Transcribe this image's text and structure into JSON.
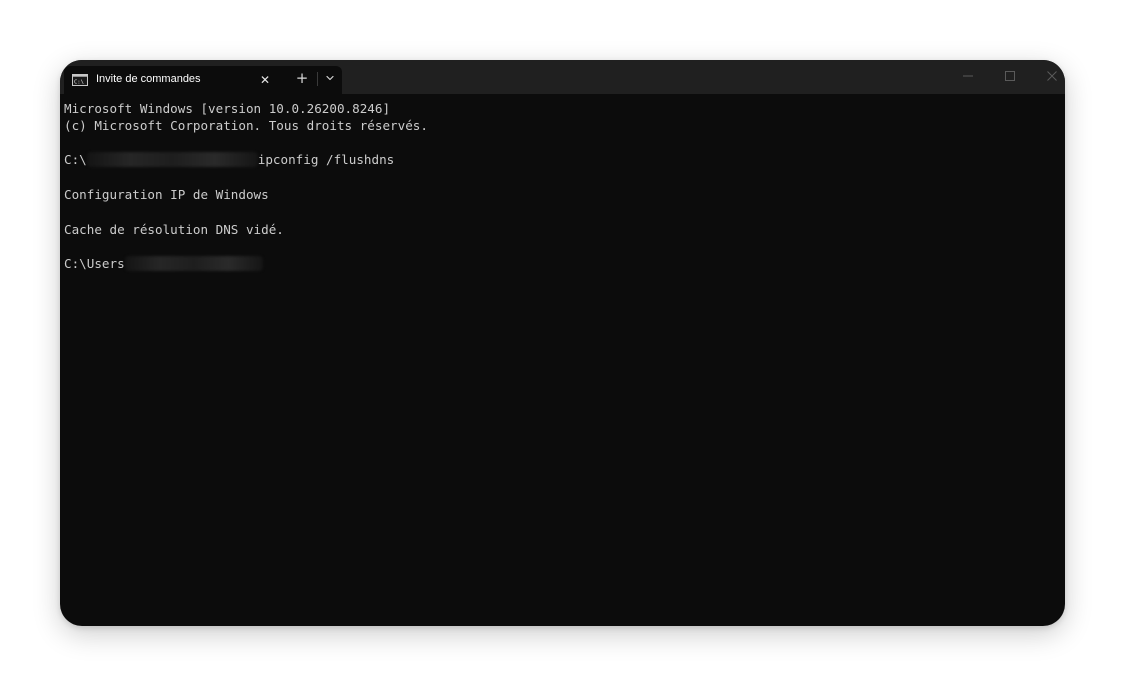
{
  "tab": {
    "title": "Invite de commandes",
    "icon": "cmd-icon",
    "close_glyph": "✕"
  },
  "titlebar": {
    "new_tab_glyph": "+",
    "dropdown_icon": "chevron-down-icon",
    "window_controls": [
      "minimize-icon",
      "maximize-icon",
      "close-icon"
    ]
  },
  "console": {
    "line1": "Microsoft Windows [version 10.0.26200.8246]",
    "line2": "(c) Microsoft Corporation. Tous droits réservés.",
    "prompt1_prefix": "C:\\",
    "command": "ipconfig /flushdns",
    "out1": "Configuration IP de Windows",
    "out2": "Cache de résolution DNS vidé.",
    "prompt2_prefix": "C:\\Users"
  },
  "colors": {
    "terminal_bg": "#0c0c0c",
    "titlebar_bg": "#202020",
    "text": "#cccccc"
  }
}
